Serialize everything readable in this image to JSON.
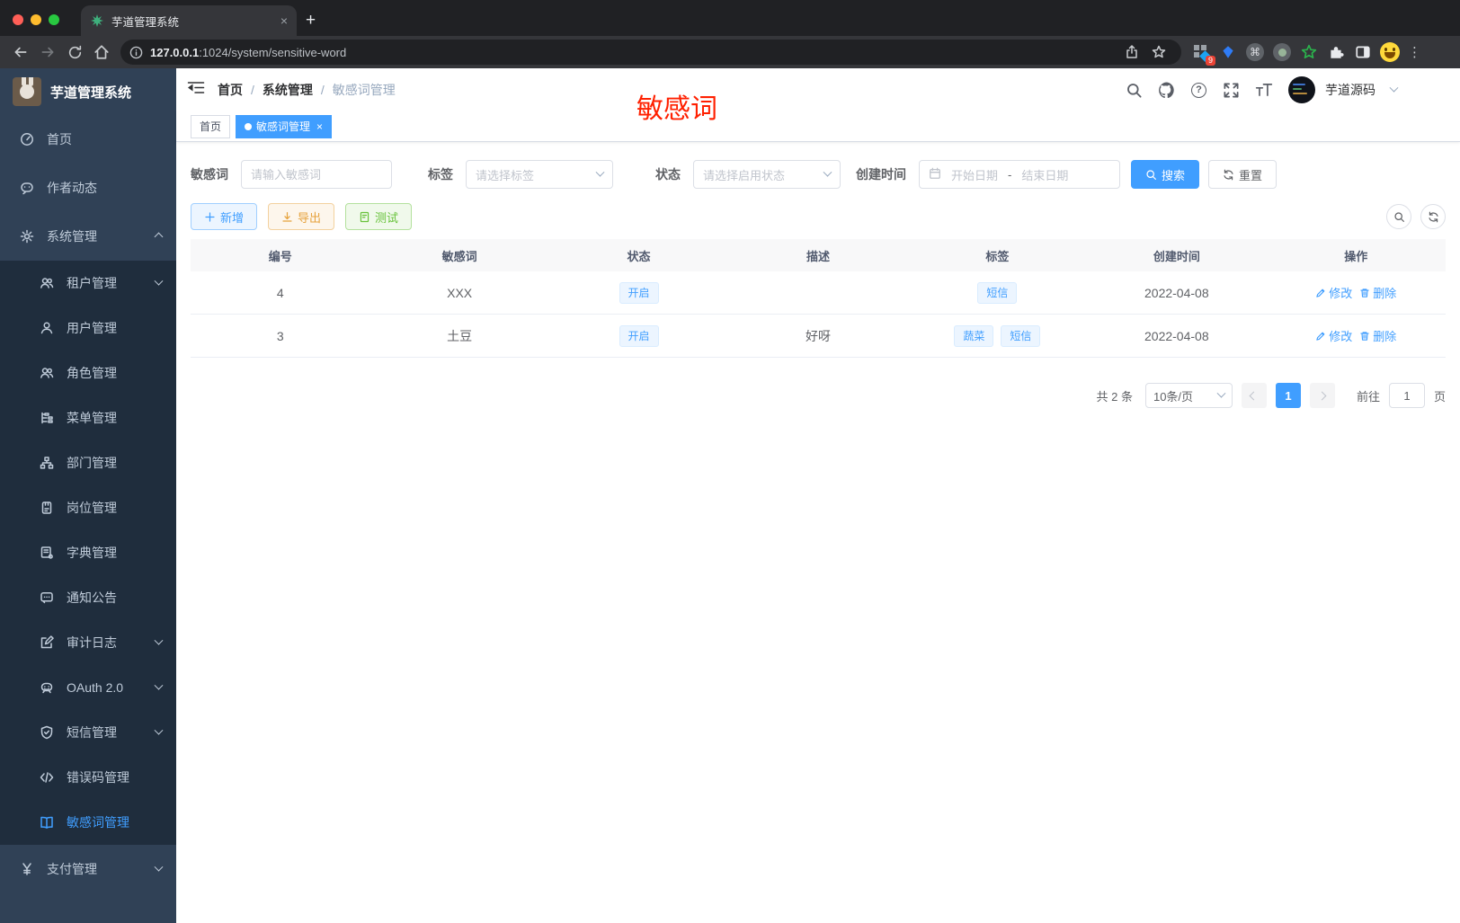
{
  "browser": {
    "tab_title": "芋道管理系统",
    "close_glyph": "×",
    "newtab_glyph": "+",
    "url_host": "127.0.0.1",
    "url_rest": ":1024/system/sensitive-word",
    "extension_badge": "9",
    "cmd_glyph": "⌘",
    "menu_dots_glyph": "⋮"
  },
  "sidebar": {
    "app_title": "芋道管理系统",
    "items": [
      {
        "label": "首页"
      },
      {
        "label": "作者动态"
      },
      {
        "label": "系统管理"
      },
      {
        "label": "租户管理"
      },
      {
        "label": "用户管理"
      },
      {
        "label": "角色管理"
      },
      {
        "label": "菜单管理"
      },
      {
        "label": "部门管理"
      },
      {
        "label": "岗位管理"
      },
      {
        "label": "字典管理"
      },
      {
        "label": "通知公告"
      },
      {
        "label": "审计日志"
      },
      {
        "label": "OAuth 2.0"
      },
      {
        "label": "短信管理"
      },
      {
        "label": "错误码管理"
      },
      {
        "label": "敏感词管理"
      },
      {
        "label": "支付管理"
      }
    ]
  },
  "navbar": {
    "breadcrumb": {
      "home": "首页",
      "sep1": "/",
      "system": "系统管理",
      "sep2": "/",
      "current": "敏感词管理"
    },
    "help_glyph": "?",
    "username": "芋道源码"
  },
  "annotation": {
    "text": "敏感词",
    "color": "#ff2000"
  },
  "tags_view": {
    "home": "首页",
    "active": "敏感词管理",
    "close_glyph": "×"
  },
  "filters": {
    "keyword_label": "敏感词",
    "keyword_placeholder": "请输入敏感词",
    "tag_label": "标签",
    "tag_placeholder": "请选择标签",
    "status_label": "状态",
    "status_placeholder": "请选择启用状态",
    "date_label": "创建时间",
    "date_start_placeholder": "开始日期",
    "date_separator": "-",
    "date_end_placeholder": "结束日期",
    "search_label": "搜索",
    "reset_label": "重置"
  },
  "toolbar": {
    "add_label": "新增",
    "export_label": "导出",
    "test_label": "测试"
  },
  "table": {
    "headers": [
      "编号",
      "敏感词",
      "状态",
      "描述",
      "标签",
      "创建时间",
      "操作"
    ],
    "edit_label": "修改",
    "delete_label": "删除",
    "rows": [
      {
        "id": "4",
        "word": "XXX",
        "status": "开启",
        "desc": "",
        "tag1": "短信",
        "created": "2022-04-08"
      },
      {
        "id": "3",
        "word": "土豆",
        "status": "开启",
        "desc": "好呀",
        "tag1": "蔬菜",
        "tag2": "短信",
        "created": "2022-04-08"
      }
    ]
  },
  "pagination": {
    "total_label": "共 2 条",
    "page_size_label": "10条/页",
    "current_page": "1",
    "goto_label": "前往",
    "goto_value": "1",
    "page_unit": "页"
  },
  "colors": {
    "accent": "#409eff",
    "sidebar_bg": "#304156",
    "submenu_bg": "#1f2d3d",
    "sidebar_text": "#bfcbd9",
    "warning": "#e6a23c",
    "success": "#67c23a",
    "tag_bg": "#ecf5ff",
    "annotation_red": "#ff2000"
  }
}
